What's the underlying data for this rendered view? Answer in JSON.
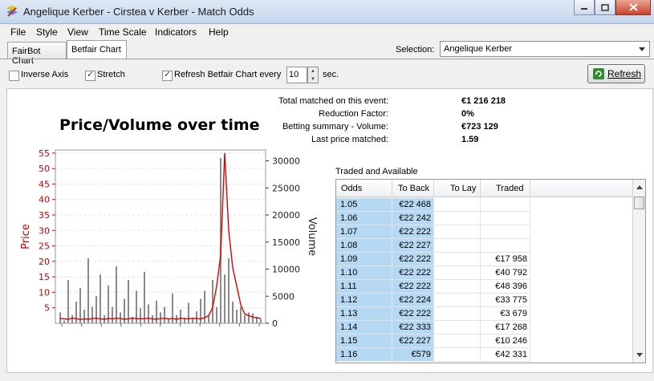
{
  "window": {
    "title": "Angelique Kerber - Cirstea v Kerber - Match Odds"
  },
  "menu": [
    "File",
    "Style",
    "View",
    "Time Scale",
    "Indicators",
    "Help"
  ],
  "tabs": [
    "FairBot Chart",
    "Betfair Chart"
  ],
  "selection": {
    "label": "Selection:",
    "value": "Angelique Kerber"
  },
  "toolbar": {
    "inverse_axis": "Inverse Axis",
    "stretch": "Stretch",
    "refresh_every": "Refresh Betfair Chart every",
    "refresh_value": "10",
    "sec": "sec.",
    "refresh_button": "Refresh"
  },
  "summary": [
    {
      "label": "Total matched on this event:",
      "value": "€1 216 218"
    },
    {
      "label": "Reduction Factor:",
      "value": "0%"
    },
    {
      "label": "Betting summary - Volume:",
      "value": "€723 129"
    },
    {
      "label": "Last price matched:",
      "value": "1.59"
    }
  ],
  "traded": {
    "title": "Traded and Available",
    "columns": [
      "Odds",
      "To Back",
      "To Lay",
      "Traded"
    ],
    "rows": [
      [
        "1.05",
        "€22 468",
        "",
        ""
      ],
      [
        "1.06",
        "€22 242",
        "",
        ""
      ],
      [
        "1.07",
        "€22 222",
        "",
        ""
      ],
      [
        "1.08",
        "€22 227",
        "",
        ""
      ],
      [
        "1.09",
        "€22 222",
        "",
        "€17 958"
      ],
      [
        "1.10",
        "€22 222",
        "",
        "€40 792"
      ],
      [
        "1.11",
        "€22 222",
        "",
        "€48 396"
      ],
      [
        "1.12",
        "€22 224",
        "",
        "€33 775"
      ],
      [
        "1.13",
        "€22 222",
        "",
        "€3 679"
      ],
      [
        "1.14",
        "€22 333",
        "",
        "€17 268"
      ],
      [
        "1.15",
        "€22 227",
        "",
        "€10 246"
      ],
      [
        "1.16",
        "€579",
        "",
        "€42 331"
      ]
    ]
  },
  "chart_data": {
    "type": "line",
    "title": "Price/Volume over time",
    "ylabel": "Price",
    "y2label": "Volume",
    "ylim": [
      0,
      56
    ],
    "y2lim": [
      0,
      32000
    ],
    "yticks": [
      "5",
      "10",
      "15",
      "20",
      "25",
      "30",
      "35",
      "40",
      "45",
      "50",
      "55"
    ],
    "y2ticks": [
      "0",
      "5000",
      "10000",
      "15000",
      "20000",
      "25000",
      "30000"
    ],
    "x": [
      0,
      2,
      4,
      6,
      8,
      10,
      12,
      14,
      16,
      18,
      20,
      22,
      24,
      26,
      28,
      30,
      32,
      34,
      36,
      38,
      40,
      42,
      44,
      46,
      48,
      50,
      52,
      54,
      56,
      58,
      60,
      62,
      64,
      66,
      68,
      70,
      72,
      74,
      76,
      78,
      80,
      82,
      84,
      86,
      88,
      90,
      92,
      94,
      96,
      98,
      100
    ],
    "series": [
      {
        "values": [
          1.5,
          1.4,
          1.3,
          1.6,
          1.5,
          1.2,
          1.4,
          1.3,
          1.5,
          1.6,
          1.4,
          1.3,
          1.5,
          1.4,
          1.6,
          1.5,
          1.3,
          1.4,
          1.6,
          1.5,
          1.4,
          1.5,
          1.6,
          1.4,
          1.3,
          1.5,
          1.6,
          1.4,
          1.5,
          1.3,
          1.6,
          1.5,
          1.4,
          1.6,
          1.5,
          1.4,
          1.8,
          2.5,
          5,
          12,
          22,
          55,
          30,
          18,
          12,
          6,
          3,
          2.5,
          2,
          1.8,
          1.6
        ]
      },
      {
        "values": [
          2000,
          500,
          8000,
          1500,
          4000,
          6500,
          2500,
          12000,
          3000,
          5000,
          9000,
          1500,
          7000,
          3000,
          10500,
          2000,
          4500,
          8000,
          1200,
          6000,
          2800,
          9500,
          3500,
          1500,
          4200,
          2000,
          3000,
          800,
          5500,
          1500,
          2500,
          1000,
          3800,
          900,
          2200,
          4500,
          6000,
          1500,
          8000,
          3000,
          30500,
          9000,
          12000,
          4000,
          2500,
          3000,
          1500,
          2000,
          1800,
          1200,
          800
        ]
      }
    ]
  }
}
